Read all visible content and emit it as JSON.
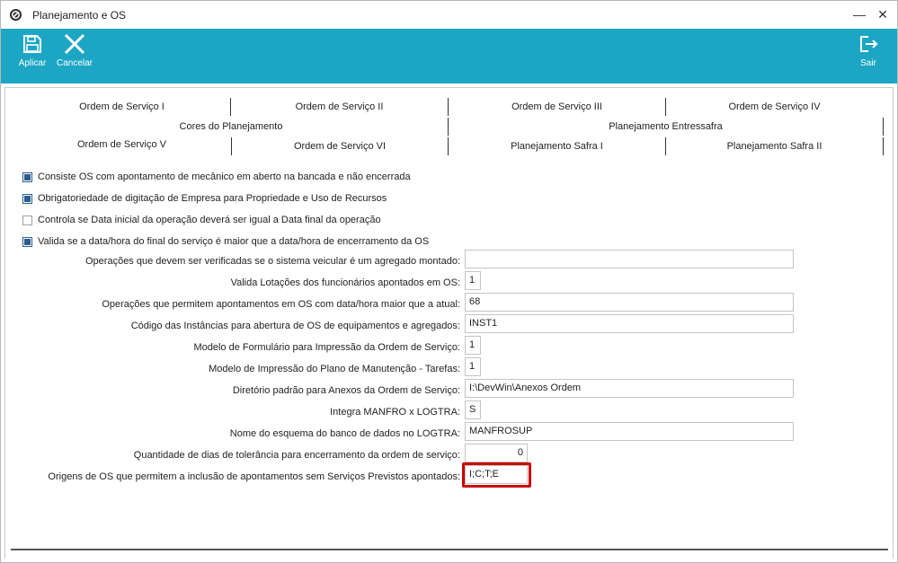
{
  "window": {
    "title": "Planejamento e OS",
    "controls": {
      "minimize": "—",
      "maximize": "□",
      "close": "✕"
    }
  },
  "toolbar": {
    "aplicar": {
      "label": "Aplicar",
      "icon": "save-icon"
    },
    "cancelar": {
      "label": "Cancelar",
      "icon": "close-x-icon"
    },
    "sair": {
      "label": "Sair",
      "icon": "exit-icon"
    },
    "color": "#1da6c4"
  },
  "tabs": {
    "row1": [
      "Ordem de Serviço I",
      "Ordem de Serviço II",
      "Ordem de Serviço III",
      "Ordem de Serviço IV"
    ],
    "row2": [
      "Cores do Planejamento",
      "Planejamento Entressafra"
    ],
    "row3": [
      "Ordem de Serviço V",
      "Ordem de Serviço VI",
      "Planejamento Safra I",
      "Planejamento Safra II"
    ]
  },
  "checkboxes": [
    {
      "label": "Consiste OS com apontamento de mecânico em aberto na bancada e não encerrada",
      "checked": true
    },
    {
      "label": "Obrigatoriedade de digitação de Empresa para Propriedade e Uso de Recursos",
      "checked": true
    },
    {
      "label": "Controla se Data inicial da operação deverá ser igual a Data final da operação",
      "checked": false
    },
    {
      "label": "Valida se a data/hora do final do serviço é maior que a data/hora de encerramento da OS",
      "checked": true
    }
  ],
  "fields": [
    {
      "label": "Operações que devem ser verificadas se o sistema veicular é um agregado montado:",
      "value": ""
    },
    {
      "label": "Valida Lotações dos funcionários apontados em OS:",
      "value": "1"
    },
    {
      "label": "Operações que permitem apontamentos em OS com data/hora maior que a atual:",
      "value": "68"
    },
    {
      "label": "Código das Instâncias para abertura de OS de equipamentos e agregados:",
      "value": "INST1"
    },
    {
      "label": "Modelo de Formulário para Impressão da Ordem de Serviço:",
      "value": "1"
    },
    {
      "label": "Modelo de Impressão do Plano de Manutenção - Tarefas:",
      "value": "1"
    },
    {
      "label": "Diretório padrão para Anexos da Ordem de Serviço:",
      "value": "I:\\DevWin\\Anexos Ordem"
    },
    {
      "label": "Integra MANFRO x LOGTRA:",
      "value": "S"
    },
    {
      "label": "Nome do esquema do banco de dados no LOGTRA:",
      "value": "MANFROSUP"
    },
    {
      "label": "Quantidade de dias de tolerância para encerramento da ordem de serviço:",
      "value": "0"
    },
    {
      "label": "Origens de OS que permitem a inclusão de apontamentos sem Serviços Previstos apontados:",
      "value": "I;C;T;E"
    }
  ],
  "highlight_color": "#cc0000"
}
